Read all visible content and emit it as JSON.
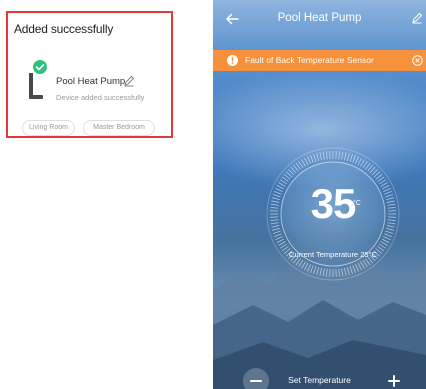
{
  "added_card": {
    "title": "Added successfully",
    "device_name": "Pool Heat Pump",
    "device_status": "Device added successfully",
    "rooms": [
      "Living Room",
      "Master Bedroom"
    ],
    "highlight_color": "#e53935",
    "success_color": "#2ec27e"
  },
  "device_screen": {
    "title": "Pool Heat Pump",
    "fault": {
      "text": "Fault of Back Temperature Sensor",
      "color": "#f4913a"
    },
    "temperature": {
      "value": "35",
      "unit": "°C",
      "caption": "Current Temperature 25°C"
    },
    "set_temperature_label": "Set Temperature",
    "icons": [
      "back-arrow-icon",
      "edit-icon",
      "warning-icon",
      "close-icon",
      "minus-icon",
      "plus-icon"
    ]
  }
}
